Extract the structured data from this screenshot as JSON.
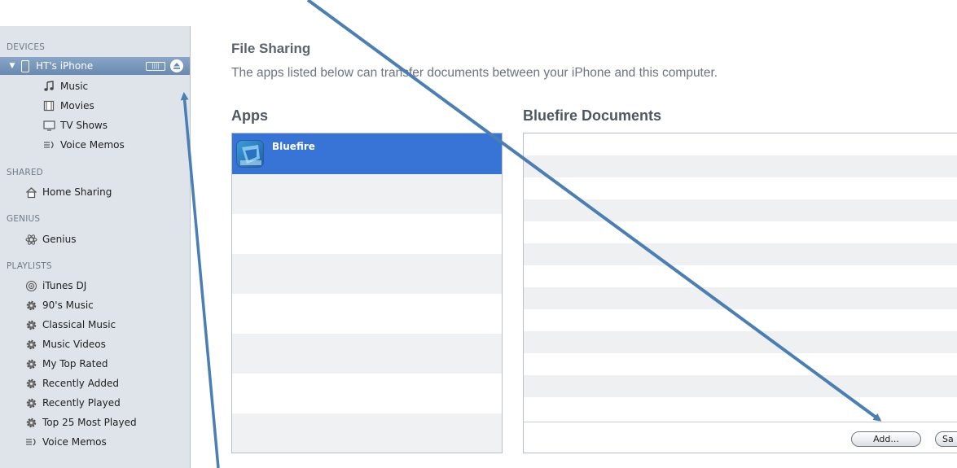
{
  "sidebar": {
    "devices_header": "DEVICES",
    "device": {
      "name": "HT's iPhone",
      "battery_text": "||||"
    },
    "device_items": [
      {
        "label": "Music",
        "icon": "music-note-icon"
      },
      {
        "label": "Movies",
        "icon": "film-icon"
      },
      {
        "label": "TV Shows",
        "icon": "tv-icon"
      },
      {
        "label": "Voice Memos",
        "icon": "voice-memo-icon"
      }
    ],
    "shared_header": "SHARED",
    "shared_items": [
      {
        "label": "Home Sharing",
        "icon": "home-icon"
      }
    ],
    "genius_header": "GENIUS",
    "genius_items": [
      {
        "label": "Genius",
        "icon": "genius-icon"
      }
    ],
    "playlists_header": "PLAYLISTS",
    "playlist_items": [
      {
        "label": "iTunes DJ",
        "icon": "dj-icon"
      },
      {
        "label": "90's Music",
        "icon": "gear-icon"
      },
      {
        "label": "Classical Music",
        "icon": "gear-icon"
      },
      {
        "label": "Music Videos",
        "icon": "gear-icon"
      },
      {
        "label": "My Top Rated",
        "icon": "gear-icon"
      },
      {
        "label": "Recently Added",
        "icon": "gear-icon"
      },
      {
        "label": "Recently Played",
        "icon": "gear-icon"
      },
      {
        "label": "Top 25 Most Played",
        "icon": "gear-icon"
      },
      {
        "label": "Voice Memos",
        "icon": "voice-memo-icon"
      }
    ]
  },
  "main": {
    "title": "File Sharing",
    "description": "The apps listed below can transfer documents between your iPhone and this computer.",
    "apps_title": "Apps",
    "apps": [
      {
        "name": "Bluefire",
        "selected": true
      }
    ],
    "docs_title": "Bluefire Documents",
    "add_label": "Add...",
    "save_label": "Sa"
  },
  "colors": {
    "selection": "#3874d6",
    "sidebar_bg": "#dfe4ea",
    "arrow": "#4a7fb5"
  }
}
